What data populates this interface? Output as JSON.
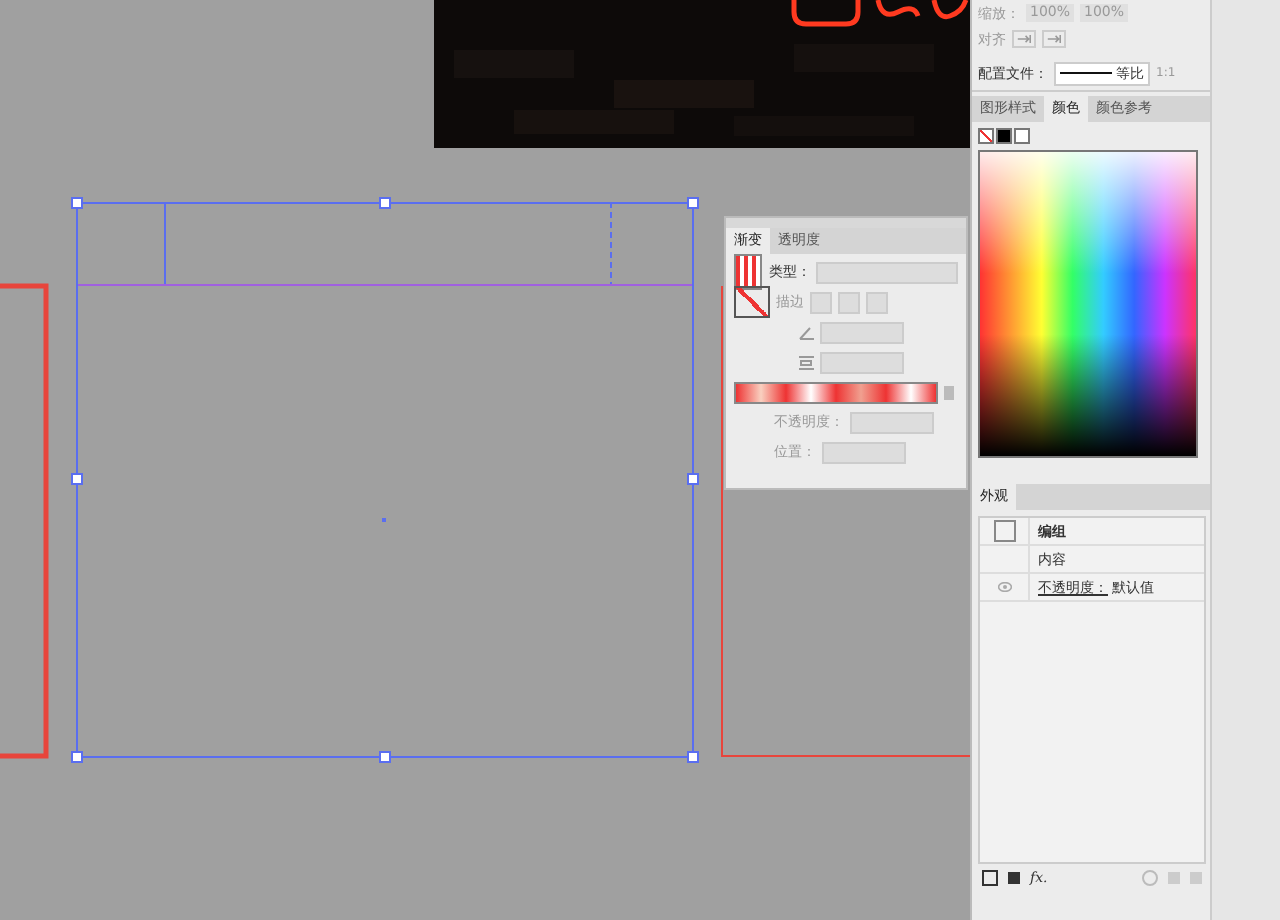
{
  "top_panel": {
    "scale_label": "缩放：",
    "scale_values": [
      "100%",
      "100%"
    ],
    "align_label": "对齐",
    "profile_label": "配置文件：",
    "profile_value": "等比",
    "profile_side": "1:1"
  },
  "color_panel": {
    "tabs": [
      {
        "label": "图形样式",
        "selected": false
      },
      {
        "label": "颜色",
        "selected": true
      },
      {
        "label": "颜色参考",
        "selected": false
      }
    ]
  },
  "gradient_panel": {
    "tabs": [
      {
        "label": "渐变",
        "selected": true
      },
      {
        "label": "透明度",
        "selected": false
      }
    ],
    "type_label": "类型：",
    "stroke_label": "描边",
    "opacity_label": "不透明度：",
    "position_label": "位置："
  },
  "appearance_panel": {
    "title": "外观",
    "rows": [
      {
        "kind": "group",
        "label": "编组"
      },
      {
        "kind": "content",
        "label": "内容"
      },
      {
        "kind": "opacity",
        "label": "不透明度：",
        "value": "默认值"
      }
    ],
    "fx": "fx."
  }
}
